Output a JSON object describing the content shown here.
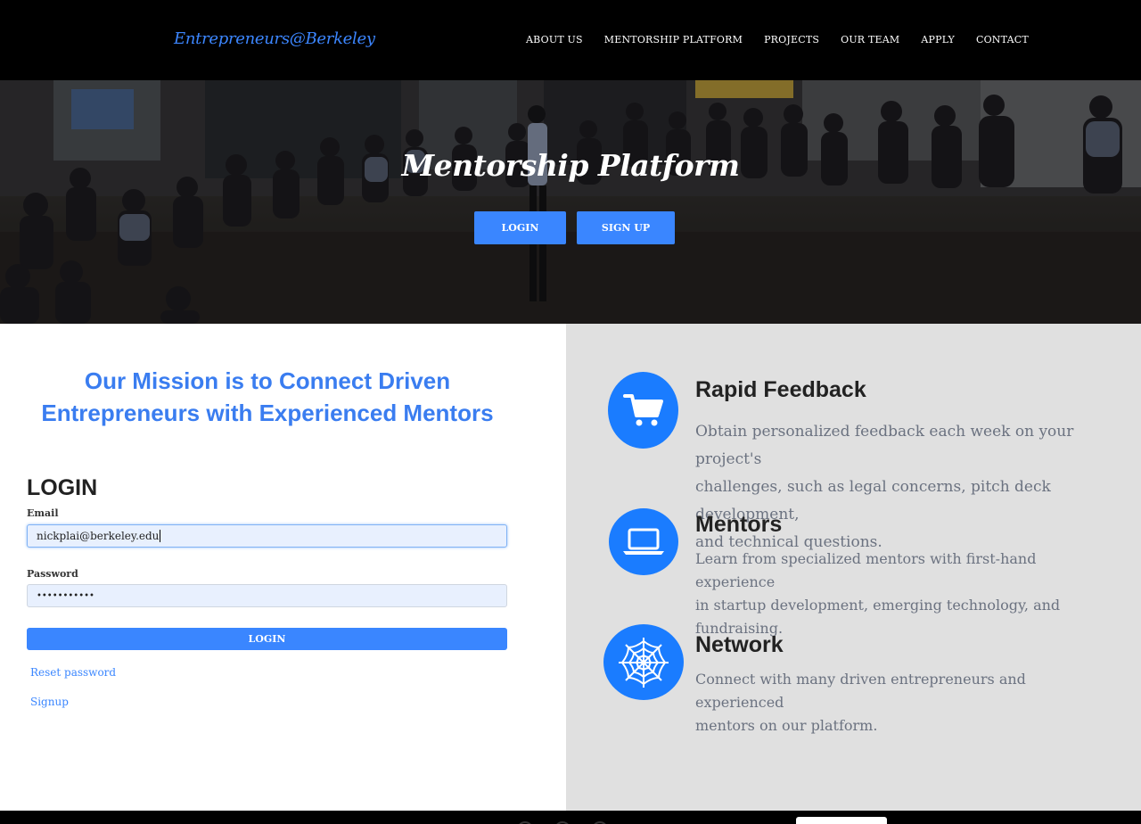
{
  "nav": {
    "brand": "Entrepreneurs@Berkeley",
    "links": [
      "ABOUT US",
      "MENTORSHIP PLATFORM",
      "PROJECTS",
      "OUR TEAM",
      "APPLY",
      "CONTACT"
    ]
  },
  "hero": {
    "title": "Mentorship Platform",
    "login_label": "LOGIN",
    "signup_label": "SIGN UP"
  },
  "mission": {
    "line1": "Our Mission is to Connect Driven",
    "line2": "Entrepreneurs with Experienced Mentors"
  },
  "login": {
    "heading": "LOGIN",
    "email_label": "Email",
    "email_value": "nickplai@berkeley.edu",
    "password_label": "Password",
    "password_value": "•••••••••••",
    "submit_label": "LOGIN",
    "reset_link": "Reset password",
    "signup_link": "Signup"
  },
  "features": [
    {
      "icon": "cart-icon",
      "title": "Rapid Feedback",
      "lines": [
        "Obtain personalized feedback each week on your project's",
        "challenges, such as legal concerns, pitch deck development,",
        "and technical questions."
      ]
    },
    {
      "icon": "laptop-icon",
      "title": "Mentors",
      "lines": [
        "Learn from specialized mentors with first-hand experience",
        "in startup development, emerging technology, and",
        "fundraising."
      ]
    },
    {
      "icon": "spider-web-icon",
      "title": "Network",
      "lines": [
        "Connect with many driven entrepreneurs and experienced",
        "mentors on our platform."
      ]
    }
  ],
  "colors": {
    "accent": "#3a86ff",
    "icon_circle": "#1a7cff",
    "nav_bg": "#000000",
    "right_bg": "#e0e0e0"
  }
}
